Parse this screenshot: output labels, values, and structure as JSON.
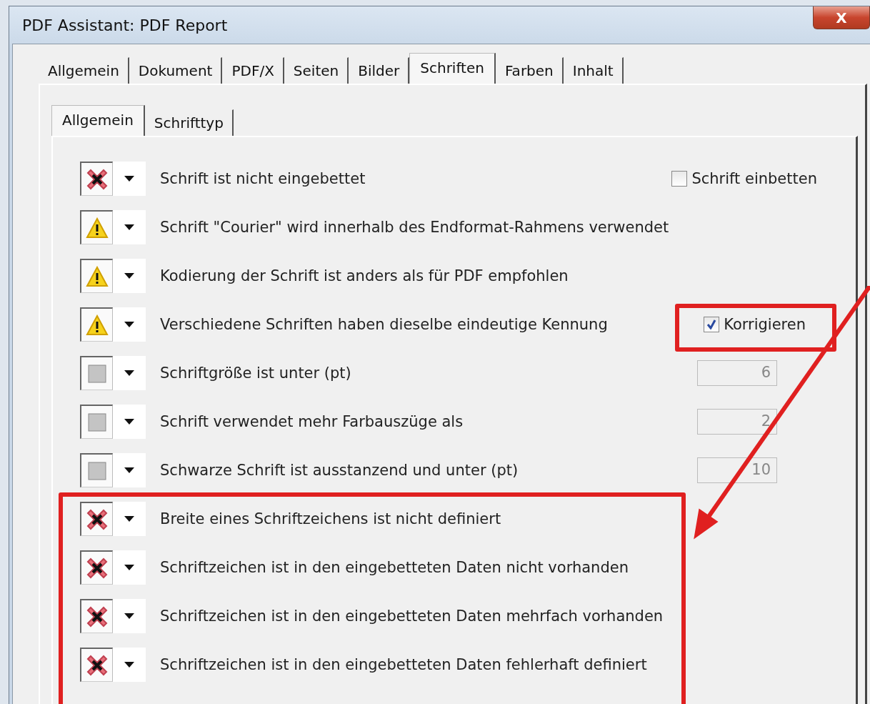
{
  "window": {
    "title": "PDF Assistant: PDF Report",
    "close": "X"
  },
  "tabs": [
    {
      "label": "Allgemein",
      "selected": false
    },
    {
      "label": "Dokument",
      "selected": false
    },
    {
      "label": "PDF/X",
      "selected": false
    },
    {
      "label": "Seiten",
      "selected": false
    },
    {
      "label": "Bilder",
      "selected": false
    },
    {
      "label": "Schriften",
      "selected": true
    },
    {
      "label": "Farben",
      "selected": false
    },
    {
      "label": "Inhalt",
      "selected": false
    }
  ],
  "subtabs": [
    {
      "label": "Allgemein",
      "selected": true
    },
    {
      "label": "Schrifttyp",
      "selected": false
    }
  ],
  "rows": [
    {
      "kind": "error",
      "text": "Schrift ist nicht eingebettet",
      "option": {
        "kind": "checkbox",
        "label": "Schrift einbetten",
        "checked": false
      }
    },
    {
      "kind": "warning",
      "text": "Schrift \"Courier\" wird innerhalb des Endformat-Rahmens verwendet"
    },
    {
      "kind": "warning",
      "text": "Kodierung der Schrift ist anders als für PDF empfohlen"
    },
    {
      "kind": "warning",
      "text": "Verschiedene Schriften haben dieselbe eindeutige Kennung",
      "option": {
        "kind": "checkbox",
        "label": "Korrigieren",
        "checked": true
      }
    },
    {
      "kind": "off",
      "text": "Schriftgröße ist unter (pt)",
      "option": {
        "kind": "number",
        "value": "6"
      }
    },
    {
      "kind": "off",
      "text": "Schrift verwendet mehr Farbauszüge als",
      "option": {
        "kind": "number",
        "value": "2"
      }
    },
    {
      "kind": "off",
      "text": "Schwarze Schrift ist ausstanzend und unter (pt)",
      "option": {
        "kind": "number",
        "value": "10"
      }
    },
    {
      "kind": "error",
      "text": "Breite eines Schriftzeichens ist nicht definiert"
    },
    {
      "kind": "error",
      "text": "Schriftzeichen ist in den eingebetteten Daten nicht vorhanden"
    },
    {
      "kind": "error",
      "text": "Schriftzeichen ist in den eingebetteten Daten mehrfach vorhanden"
    },
    {
      "kind": "error",
      "text": "Schriftzeichen ist in den eingebetteten Daten fehlerhaft definiert"
    }
  ]
}
